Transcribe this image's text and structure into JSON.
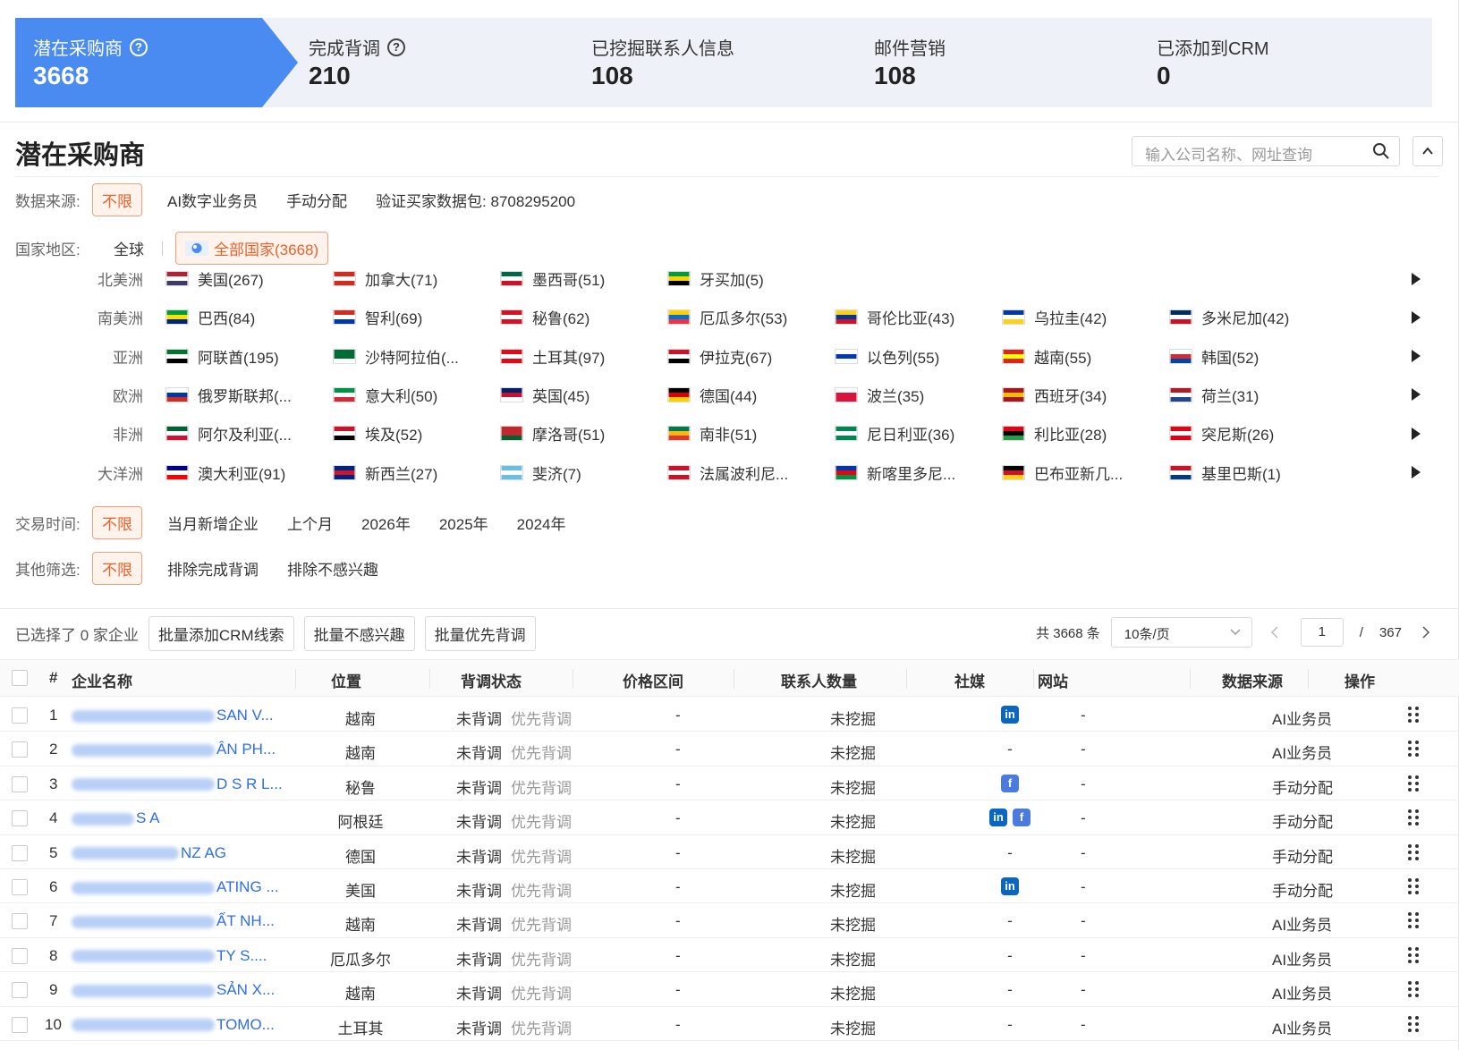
{
  "funnel": [
    {
      "label": "潜在采购商",
      "value": "3668",
      "help": true
    },
    {
      "label": "完成背调",
      "value": "210",
      "help": true
    },
    {
      "label": "已挖掘联系人信息",
      "value": "108"
    },
    {
      "label": "邮件营销",
      "value": "108"
    },
    {
      "label": "已添加到CRM",
      "value": "0"
    }
  ],
  "header": {
    "title": "潜在采购商",
    "search_placeholder": "输入公司名称、网址查询"
  },
  "filters": {
    "source": {
      "label": "数据来源:",
      "options": [
        "不限",
        "AI数字业务员",
        "手动分配",
        "验证买家数据包: 8708295200"
      ],
      "selected": 0
    },
    "country": {
      "label": "国家地区:",
      "global": "全球",
      "all": "全部国家(3668)"
    },
    "time": {
      "label": "交易时间:",
      "options": [
        "不限",
        "当月新增企业",
        "上个月",
        "2026年",
        "2025年",
        "2024年"
      ],
      "selected": 0
    },
    "other": {
      "label": "其他筛选:",
      "options": [
        "不限",
        "排除完成背调",
        "排除不感兴趣"
      ],
      "selected": 0
    }
  },
  "regions": [
    {
      "name": "北美洲",
      "countries": [
        "美国(267)",
        "加拿大(71)",
        "墨西哥(51)",
        "牙买加(5)"
      ]
    },
    {
      "name": "南美洲",
      "countries": [
        "巴西(84)",
        "智利(69)",
        "秘鲁(62)",
        "厄瓜多尔(53)",
        "哥伦比亚(43)",
        "乌拉圭(42)",
        "多米尼加(42)"
      ]
    },
    {
      "name": "亚洲",
      "countries": [
        "阿联酋(195)",
        "沙特阿拉伯(...",
        "土耳其(97)",
        "伊拉克(67)",
        "以色列(55)",
        "越南(55)",
        "韩国(52)"
      ]
    },
    {
      "name": "欧洲",
      "countries": [
        "俄罗斯联邦(...",
        "意大利(50)",
        "英国(45)",
        "德国(44)",
        "波兰(35)",
        "西班牙(34)",
        "荷兰(31)"
      ]
    },
    {
      "name": "非洲",
      "countries": [
        "阿尔及利亚(...",
        "埃及(52)",
        "摩洛哥(51)",
        "南非(51)",
        "尼日利亚(36)",
        "利比亚(28)",
        "突尼斯(26)"
      ]
    },
    {
      "name": "大洋洲",
      "countries": [
        "澳大利亚(91)",
        "新西兰(27)",
        "斐济(7)",
        "法属波利尼...",
        "新喀里多尼...",
        "巴布亚新几...",
        "基里巴斯(1)"
      ]
    }
  ],
  "flags": [
    [
      [
        "#b22234",
        "#ffffff",
        "#3c3b6e"
      ],
      [
        "#d52b1e",
        "#ffffff",
        "#d52b1e"
      ],
      [
        "#006847",
        "#ffffff",
        "#ce1126"
      ],
      [
        "#009b3a",
        "#fed100",
        "#000000"
      ]
    ],
    [
      [
        "#009c3b",
        "#ffdf00",
        "#002776"
      ],
      [
        "#d52b1e",
        "#ffffff",
        "#0039a6"
      ],
      [
        "#d91023",
        "#ffffff",
        "#d91023"
      ],
      [
        "#ffd100",
        "#0072ce",
        "#ef3340"
      ],
      [
        "#fcd116",
        "#003893",
        "#ce1126"
      ],
      [
        "#0038a8",
        "#ffffff",
        "#fcd116"
      ],
      [
        "#002d62",
        "#ffffff",
        "#ce1126"
      ]
    ],
    [
      [
        "#00732f",
        "#ffffff",
        "#000000"
      ],
      [
        "#006c35",
        "#006c35",
        "#ffffff"
      ],
      [
        "#e30a17",
        "#ffffff",
        "#e30a17"
      ],
      [
        "#ce1126",
        "#ffffff",
        "#000000"
      ],
      [
        "#ffffff",
        "#0038b8",
        "#ffffff"
      ],
      [
        "#da251d",
        "#ffff00",
        "#da251d"
      ],
      [
        "#ffffff",
        "#cd2e3a",
        "#0047a0"
      ]
    ],
    [
      [
        "#ffffff",
        "#0039a6",
        "#d52b1e"
      ],
      [
        "#009246",
        "#ffffff",
        "#ce2b37"
      ],
      [
        "#012169",
        "#c8102e",
        "#ffffff"
      ],
      [
        "#000000",
        "#dd0000",
        "#ffce00"
      ],
      [
        "#ffffff",
        "#dc143c",
        "#dc143c"
      ],
      [
        "#aa151b",
        "#f1bf00",
        "#aa151b"
      ],
      [
        "#ae1c28",
        "#ffffff",
        "#21468b"
      ]
    ],
    [
      [
        "#006233",
        "#ffffff",
        "#d21034"
      ],
      [
        "#ce1126",
        "#ffffff",
        "#000000"
      ],
      [
        "#c1272d",
        "#c1272d",
        "#006233"
      ],
      [
        "#007a4d",
        "#ffb612",
        "#de3831"
      ],
      [
        "#008751",
        "#ffffff",
        "#008751"
      ],
      [
        "#e70013",
        "#000000",
        "#239e46"
      ],
      [
        "#e70013",
        "#ffffff",
        "#e70013"
      ]
    ],
    [
      [
        "#00008b",
        "#ffffff",
        "#ff0000"
      ],
      [
        "#00247d",
        "#cc142b",
        "#00247d"
      ],
      [
        "#68bfe5",
        "#ffffff",
        "#68bfe5"
      ],
      [
        "#ce1126",
        "#ffffff",
        "#ce1126"
      ],
      [
        "#0035ad",
        "#e20613",
        "#009543"
      ],
      [
        "#000000",
        "#ce1126",
        "#fcd116"
      ],
      [
        "#ce1126",
        "#ffffff",
        "#003f87"
      ]
    ]
  ],
  "toolbar": {
    "selected_text": "已选择了 0 家企业",
    "buttons": [
      "批量添加CRM线索",
      "批量不感兴趣",
      "批量优先背调"
    ],
    "total": "共 3668 条",
    "page_size": "10条/页",
    "page": "1",
    "page_sep": "/",
    "pages": "367"
  },
  "columns": [
    "#",
    "企业名称",
    "位置",
    "背调状态",
    "价格区间",
    "联系人数量",
    "社媒",
    "网站",
    "数据来源",
    "操作"
  ],
  "rows": [
    {
      "no": "1",
      "name_visible": "SAN V...",
      "location": "越南",
      "status": "未背调",
      "action": "优先背调",
      "price": "-",
      "contacts": "未挖掘",
      "social": [
        "li"
      ],
      "website": "-",
      "source": "AI业务员"
    },
    {
      "no": "2",
      "name_visible": "ÂN PH...",
      "location": "越南",
      "status": "未背调",
      "action": "优先背调",
      "price": "-",
      "contacts": "未挖掘",
      "social": [],
      "website": "-",
      "source": "AI业务员"
    },
    {
      "no": "3",
      "name_visible": "D S R L...",
      "location": "秘鲁",
      "status": "未背调",
      "action": "优先背调",
      "price": "-",
      "contacts": "未挖掘",
      "social": [
        "fb"
      ],
      "website": "-",
      "source": "手动分配"
    },
    {
      "no": "4",
      "name_visible": "S A",
      "location": "阿根廷",
      "status": "未背调",
      "action": "优先背调",
      "price": "-",
      "contacts": "未挖掘",
      "social": [
        "li",
        "fb"
      ],
      "website": "-",
      "source": "手动分配"
    },
    {
      "no": "5",
      "name_visible": "NZ AG",
      "location": "德国",
      "status": "未背调",
      "action": "优先背调",
      "price": "-",
      "contacts": "未挖掘",
      "social": [],
      "website": "-",
      "source": "手动分配"
    },
    {
      "no": "6",
      "name_visible": "ATING ...",
      "location": "美国",
      "status": "未背调",
      "action": "优先背调",
      "price": "-",
      "contacts": "未挖掘",
      "social": [
        "li"
      ],
      "website": "-",
      "source": "手动分配"
    },
    {
      "no": "7",
      "name_visible": "ẤT NH...",
      "location": "越南",
      "status": "未背调",
      "action": "优先背调",
      "price": "-",
      "contacts": "未挖掘",
      "social": [],
      "website": "-",
      "source": "AI业务员"
    },
    {
      "no": "8",
      "name_visible": "TY S....",
      "location": "厄瓜多尔",
      "status": "未背调",
      "action": "优先背调",
      "price": "-",
      "contacts": "未挖掘",
      "social": [],
      "website": "-",
      "source": "AI业务员"
    },
    {
      "no": "9",
      "name_visible": "SẢN X...",
      "location": "越南",
      "status": "未背调",
      "action": "优先背调",
      "price": "-",
      "contacts": "未挖掘",
      "social": [],
      "website": "-",
      "source": "AI业务员"
    },
    {
      "no": "10",
      "name_visible": "TOMO...",
      "location": "土耳其",
      "status": "未背调",
      "action": "优先背调",
      "price": "-",
      "contacts": "未挖掘",
      "social": [],
      "website": "-",
      "source": "AI业务员"
    }
  ],
  "social_labels": {
    "li": "in",
    "fb": "f"
  },
  "colors": {
    "accent": "#2f6ee8",
    "brand_orange": "#e8622c",
    "funnel_active": "#4a8bf2",
    "funnel_bg": "#eef2f8"
  }
}
